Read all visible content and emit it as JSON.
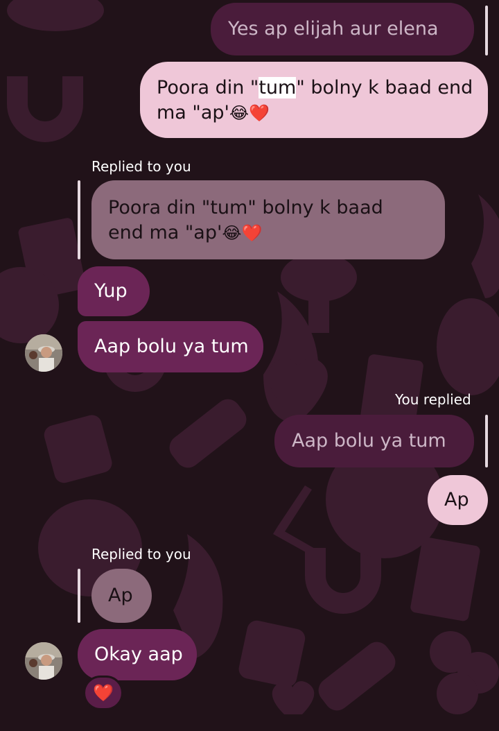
{
  "messages": [
    {
      "kind": "outgoing-quote",
      "text": "Yes ap elijah aur elena"
    },
    {
      "kind": "outgoing",
      "line1_pre": "Poora din \"",
      "line1_hl": "tum",
      "line1_post": "\" bolny k baad end",
      "line2": "ma \"ap'",
      "emoji": "😂❤️"
    },
    {
      "kind": "incoming-quote",
      "label": "Replied to you",
      "line1": "Poora din \"tum\" bolny k baad",
      "line2": "end ma \"ap'",
      "emoji": "😂❤️"
    },
    {
      "kind": "incoming",
      "text": "Yup"
    },
    {
      "kind": "incoming",
      "text": "Aap bolu ya tum"
    },
    {
      "kind": "outgoing-quote",
      "label": "You replied",
      "text": "Aap bolu ya tum"
    },
    {
      "kind": "outgoing",
      "text": "Ap"
    },
    {
      "kind": "incoming-quote",
      "label": "Replied to you",
      "text": "Ap"
    },
    {
      "kind": "incoming",
      "text": "Okay aap",
      "reaction": "❤️"
    }
  ],
  "colors": {
    "background": "#211219",
    "outgoing_bubble": "#efc7d8",
    "incoming_bubble": "#6b2556",
    "quote_bubble": "#8c6a7b",
    "accent": "#e8334a"
  },
  "icons": [
    "avatar-photo",
    "heart-reaction-icon"
  ]
}
